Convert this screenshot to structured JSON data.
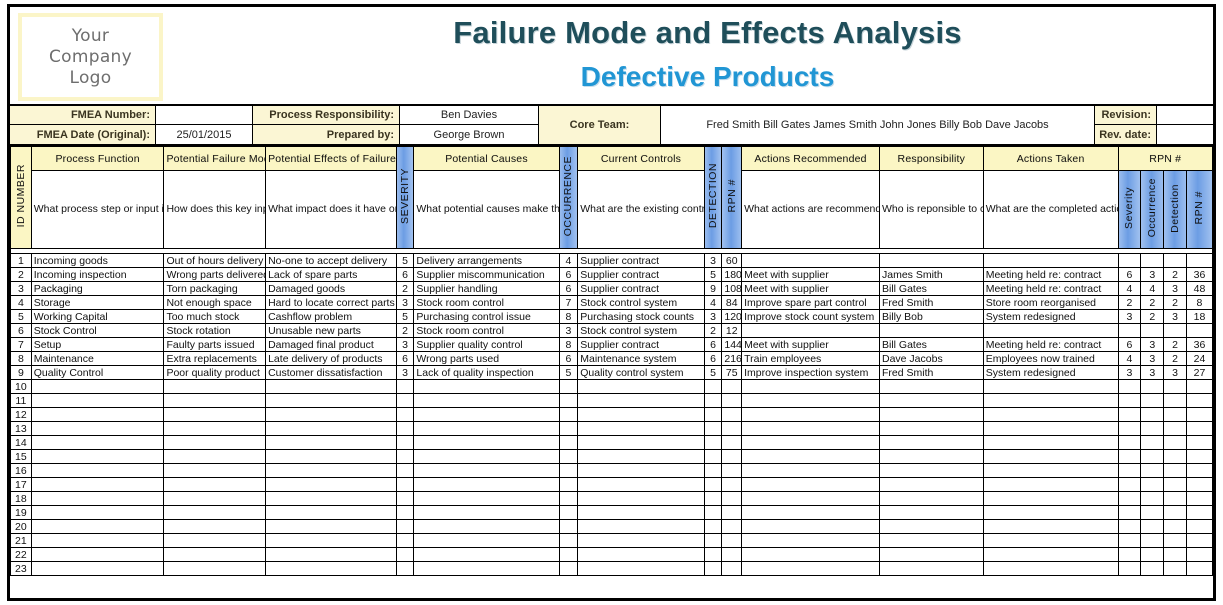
{
  "logo": {
    "line1": "Your",
    "line2": "Company",
    "line3": "Logo"
  },
  "title": {
    "main": "Failure Mode and Effects Analysis",
    "sub": "Defective Products"
  },
  "info": {
    "fmea_number_label": "FMEA Number:",
    "fmea_number_value": "",
    "fmea_date_label": "FMEA Date (Original):",
    "fmea_date_value": "25/01/2015",
    "process_responsibility_label": "Process Responsibility:",
    "process_responsibility_value": "Ben Davies",
    "prepared_by_label": "Prepared by:",
    "prepared_by_value": "George Brown",
    "core_team_label": "Core Team:",
    "core_team_value": "Fred Smith  Bill Gates  James Smith  John Jones  Billy Bob  Dave Jacobs",
    "revision_label": "Revision:",
    "revision_value": "",
    "rev_date_label": "Rev. date:",
    "rev_date_value": ""
  },
  "headers": {
    "id_number": "ID NUMBER",
    "process_function": "Process Function",
    "potential_failure_mode": "Potential Failure Mode",
    "potential_effects": "Potential Effects of Failure",
    "severity": "SEVERITY",
    "potential_causes": "Potential Causes",
    "occurrence": "OCCURRENCE",
    "current_controls": "Current Controls",
    "detection": "DETECTION",
    "rpn": "RPN #",
    "recommended_actions": "Actions Recommended",
    "responsibility": "Responsibility",
    "actions_taken": "Actions Taken",
    "severity2": "Severity",
    "occurrence2": "Occurrence",
    "detection2": "Detection",
    "rpn2": "RPN #"
  },
  "descriptions": {
    "process_function": "What process step or input is under investigation?",
    "potential_failure_mode": "How does this key input go wrong?",
    "potential_effects": "What impact does it have on the key outputs (customer requirements)?",
    "potential_causes": "What potential causes make this key input go wrong?",
    "current_controls": "What are the existing control measures that prevent either the cause or the failure mode?",
    "recommended_actions": "What actions are recommended to reduce the occurrence of the cause / improve detection?",
    "responsibility": "Who is reponsible to complete these actions?",
    "actions_taken": "What are the completed actions with respect to RPN?"
  },
  "rows": [
    {
      "id": "1",
      "process_function": "Incoming goods",
      "failure_mode": "Out of hours delivery",
      "effects": "No-one to accept delivery",
      "severity": "5",
      "causes": "Delivery arrangements",
      "occurrence": "4",
      "controls": "Supplier contract",
      "detection": "3",
      "rpn": "60",
      "actions": "",
      "responsibility": "",
      "actions_taken": "",
      "severity2": "",
      "occurrence2": "",
      "detection2": "",
      "rpn2": ""
    },
    {
      "id": "2",
      "process_function": "Incoming inspection",
      "failure_mode": "Wrong parts delivered",
      "effects": "Lack of spare parts",
      "severity": "6",
      "causes": "Supplier miscommunication",
      "occurrence": "6",
      "controls": "Supplier contract",
      "detection": "5",
      "rpn": "180",
      "actions": "Meet with supplier",
      "responsibility": "James Smith",
      "actions_taken": "Meeting held re: contract",
      "severity2": "6",
      "occurrence2": "3",
      "detection2": "2",
      "rpn2": "36"
    },
    {
      "id": "3",
      "process_function": "Packaging",
      "failure_mode": "Torn packaging",
      "effects": "Damaged goods",
      "severity": "2",
      "causes": "Supplier handling",
      "occurrence": "6",
      "controls": "Supplier contract",
      "detection": "9",
      "rpn": "108",
      "actions": "Meet with supplier",
      "responsibility": "Bill Gates",
      "actions_taken": "Meeting held re: contract",
      "severity2": "4",
      "occurrence2": "4",
      "detection2": "3",
      "rpn2": "48"
    },
    {
      "id": "4",
      "process_function": "Storage",
      "failure_mode": "Not enough space",
      "effects": "Hard to locate correct parts",
      "severity": "3",
      "causes": "Stock room control",
      "occurrence": "7",
      "controls": "Stock control system",
      "detection": "4",
      "rpn": "84",
      "actions": "Improve spare part control",
      "responsibility": "Fred Smith",
      "actions_taken": "Store room reorganised",
      "severity2": "2",
      "occurrence2": "2",
      "detection2": "2",
      "rpn2": "8"
    },
    {
      "id": "5",
      "process_function": "Working Capital",
      "failure_mode": "Too much stock",
      "effects": "Cashflow problem",
      "severity": "5",
      "causes": "Purchasing control issue",
      "occurrence": "8",
      "controls": "Purchasing stock counts",
      "detection": "3",
      "rpn": "120",
      "actions": "Improve stock count system",
      "responsibility": "Billy Bob",
      "actions_taken": "System redesigned",
      "severity2": "3",
      "occurrence2": "2",
      "detection2": "3",
      "rpn2": "18"
    },
    {
      "id": "6",
      "process_function": "Stock Control",
      "failure_mode": "Stock rotation",
      "effects": "Unusable new parts",
      "severity": "2",
      "causes": "Stock room control",
      "occurrence": "3",
      "controls": "Stock control system",
      "detection": "2",
      "rpn": "12",
      "actions": "",
      "responsibility": "",
      "actions_taken": "",
      "severity2": "",
      "occurrence2": "",
      "detection2": "",
      "rpn2": ""
    },
    {
      "id": "7",
      "process_function": "Setup",
      "failure_mode": "Faulty parts issued",
      "effects": "Damaged final product",
      "severity": "3",
      "causes": "Supplier quality control",
      "occurrence": "8",
      "controls": "Supplier contract",
      "detection": "6",
      "rpn": "144",
      "actions": "Meet with supplier",
      "responsibility": "Bill Gates",
      "actions_taken": "Meeting held re: contract",
      "severity2": "6",
      "occurrence2": "3",
      "detection2": "2",
      "rpn2": "36"
    },
    {
      "id": "8",
      "process_function": "Maintenance",
      "failure_mode": "Extra replacements",
      "effects": "Late delivery of products",
      "severity": "6",
      "causes": "Wrong parts used",
      "occurrence": "6",
      "controls": "Maintenance system",
      "detection": "6",
      "rpn": "216",
      "actions": "Train employees",
      "responsibility": "Dave Jacobs",
      "actions_taken": "Employees now trained",
      "severity2": "4",
      "occurrence2": "3",
      "detection2": "2",
      "rpn2": "24"
    },
    {
      "id": "9",
      "process_function": "Quality Control",
      "failure_mode": "Poor quality product",
      "effects": "Customer dissatisfaction",
      "severity": "3",
      "causes": "Lack of quality inspection",
      "occurrence": "5",
      "controls": "Quality control system",
      "detection": "5",
      "rpn": "75",
      "actions": "Improve inspection system",
      "responsibility": "Fred Smith",
      "actions_taken": "System redesigned",
      "severity2": "3",
      "occurrence2": "3",
      "detection2": "3",
      "rpn2": "27"
    },
    {
      "id": "10",
      "process_function": "",
      "failure_mode": "",
      "effects": "",
      "severity": "",
      "causes": "",
      "occurrence": "",
      "controls": "",
      "detection": "",
      "rpn": "",
      "actions": "",
      "responsibility": "",
      "actions_taken": "",
      "severity2": "",
      "occurrence2": "",
      "detection2": "",
      "rpn2": ""
    },
    {
      "id": "11",
      "process_function": "",
      "failure_mode": "",
      "effects": "",
      "severity": "",
      "causes": "",
      "occurrence": "",
      "controls": "",
      "detection": "",
      "rpn": "",
      "actions": "",
      "responsibility": "",
      "actions_taken": "",
      "severity2": "",
      "occurrence2": "",
      "detection2": "",
      "rpn2": ""
    },
    {
      "id": "12",
      "process_function": "",
      "failure_mode": "",
      "effects": "",
      "severity": "",
      "causes": "",
      "occurrence": "",
      "controls": "",
      "detection": "",
      "rpn": "",
      "actions": "",
      "responsibility": "",
      "actions_taken": "",
      "severity2": "",
      "occurrence2": "",
      "detection2": "",
      "rpn2": ""
    },
    {
      "id": "13",
      "process_function": "",
      "failure_mode": "",
      "effects": "",
      "severity": "",
      "causes": "",
      "occurrence": "",
      "controls": "",
      "detection": "",
      "rpn": "",
      "actions": "",
      "responsibility": "",
      "actions_taken": "",
      "severity2": "",
      "occurrence2": "",
      "detection2": "",
      "rpn2": ""
    },
    {
      "id": "14",
      "process_function": "",
      "failure_mode": "",
      "effects": "",
      "severity": "",
      "causes": "",
      "occurrence": "",
      "controls": "",
      "detection": "",
      "rpn": "",
      "actions": "",
      "responsibility": "",
      "actions_taken": "",
      "severity2": "",
      "occurrence2": "",
      "detection2": "",
      "rpn2": ""
    },
    {
      "id": "15",
      "process_function": "",
      "failure_mode": "",
      "effects": "",
      "severity": "",
      "causes": "",
      "occurrence": "",
      "controls": "",
      "detection": "",
      "rpn": "",
      "actions": "",
      "responsibility": "",
      "actions_taken": "",
      "severity2": "",
      "occurrence2": "",
      "detection2": "",
      "rpn2": ""
    },
    {
      "id": "16",
      "process_function": "",
      "failure_mode": "",
      "effects": "",
      "severity": "",
      "causes": "",
      "occurrence": "",
      "controls": "",
      "detection": "",
      "rpn": "",
      "actions": "",
      "responsibility": "",
      "actions_taken": "",
      "severity2": "",
      "occurrence2": "",
      "detection2": "",
      "rpn2": ""
    },
    {
      "id": "17",
      "process_function": "",
      "failure_mode": "",
      "effects": "",
      "severity": "",
      "causes": "",
      "occurrence": "",
      "controls": "",
      "detection": "",
      "rpn": "",
      "actions": "",
      "responsibility": "",
      "actions_taken": "",
      "severity2": "",
      "occurrence2": "",
      "detection2": "",
      "rpn2": ""
    },
    {
      "id": "18",
      "process_function": "",
      "failure_mode": "",
      "effects": "",
      "severity": "",
      "causes": "",
      "occurrence": "",
      "controls": "",
      "detection": "",
      "rpn": "",
      "actions": "",
      "responsibility": "",
      "actions_taken": "",
      "severity2": "",
      "occurrence2": "",
      "detection2": "",
      "rpn2": ""
    },
    {
      "id": "19",
      "process_function": "",
      "failure_mode": "",
      "effects": "",
      "severity": "",
      "causes": "",
      "occurrence": "",
      "controls": "",
      "detection": "",
      "rpn": "",
      "actions": "",
      "responsibility": "",
      "actions_taken": "",
      "severity2": "",
      "occurrence2": "",
      "detection2": "",
      "rpn2": ""
    },
    {
      "id": "20",
      "process_function": "",
      "failure_mode": "",
      "effects": "",
      "severity": "",
      "causes": "",
      "occurrence": "",
      "controls": "",
      "detection": "",
      "rpn": "",
      "actions": "",
      "responsibility": "",
      "actions_taken": "",
      "severity2": "",
      "occurrence2": "",
      "detection2": "",
      "rpn2": ""
    },
    {
      "id": "21",
      "process_function": "",
      "failure_mode": "",
      "effects": "",
      "severity": "",
      "causes": "",
      "occurrence": "",
      "controls": "",
      "detection": "",
      "rpn": "",
      "actions": "",
      "responsibility": "",
      "actions_taken": "",
      "severity2": "",
      "occurrence2": "",
      "detection2": "",
      "rpn2": ""
    },
    {
      "id": "22",
      "process_function": "",
      "failure_mode": "",
      "effects": "",
      "severity": "",
      "causes": "",
      "occurrence": "",
      "controls": "",
      "detection": "",
      "rpn": "",
      "actions": "",
      "responsibility": "",
      "actions_taken": "",
      "severity2": "",
      "occurrence2": "",
      "detection2": "",
      "rpn2": ""
    },
    {
      "id": "23",
      "process_function": "",
      "failure_mode": "",
      "effects": "",
      "severity": "",
      "causes": "",
      "occurrence": "",
      "controls": "",
      "detection": "",
      "rpn": "",
      "actions": "",
      "responsibility": "",
      "actions_taken": "",
      "severity2": "",
      "occurrence2": "",
      "detection2": "",
      "rpn2": ""
    }
  ],
  "colors": {
    "header_yellow": "#fbf6c4",
    "header_blue": "#7aa9e8",
    "title_main": "#1f4e5a",
    "title_sub": "#2196d4"
  }
}
